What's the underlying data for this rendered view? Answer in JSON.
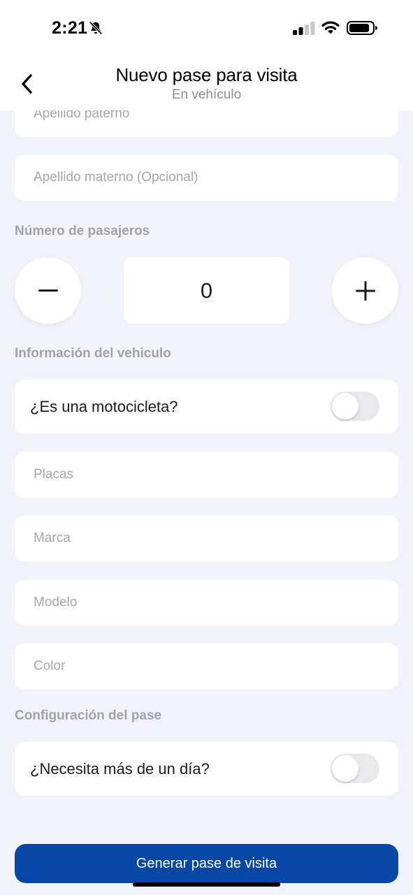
{
  "status_bar": {
    "time": "2:21",
    "icons": [
      "bell-slash-icon",
      "cellular-signal-icon",
      "wifi-icon",
      "battery-icon"
    ]
  },
  "nav": {
    "title": "Nuevo pase para visita",
    "subtitle": "En vehículo",
    "back_icon": "chevron-left-icon"
  },
  "form": {
    "apellido_paterno_placeholder": "Apellido paterno",
    "apellido_materno_placeholder": "Apellido materno (Opcional)",
    "pasajeros": {
      "label": "Número de pasajeros",
      "value": "0",
      "decrement_icon": "minus-icon",
      "increment_icon": "plus-icon"
    },
    "vehiculo": {
      "section_label": "Información del vehiculo",
      "motocicleta_label": "¿Es una motocicleta?",
      "motocicleta_on": false,
      "placas_placeholder": "Placas",
      "marca_placeholder": "Marca",
      "modelo_placeholder": "Modelo",
      "color_placeholder": "Color"
    },
    "pase": {
      "section_label": "Configuración del pase",
      "multi_dia_label": "¿Necesita más de un día?",
      "multi_dia_on": false
    }
  },
  "submit_label": "Generar pase de visita",
  "colors": {
    "primary": "#0747a6",
    "background": "#f2f2fa",
    "card": "#ffffff",
    "placeholder": "#a6a6ab",
    "section_label": "#a2a2a8"
  }
}
